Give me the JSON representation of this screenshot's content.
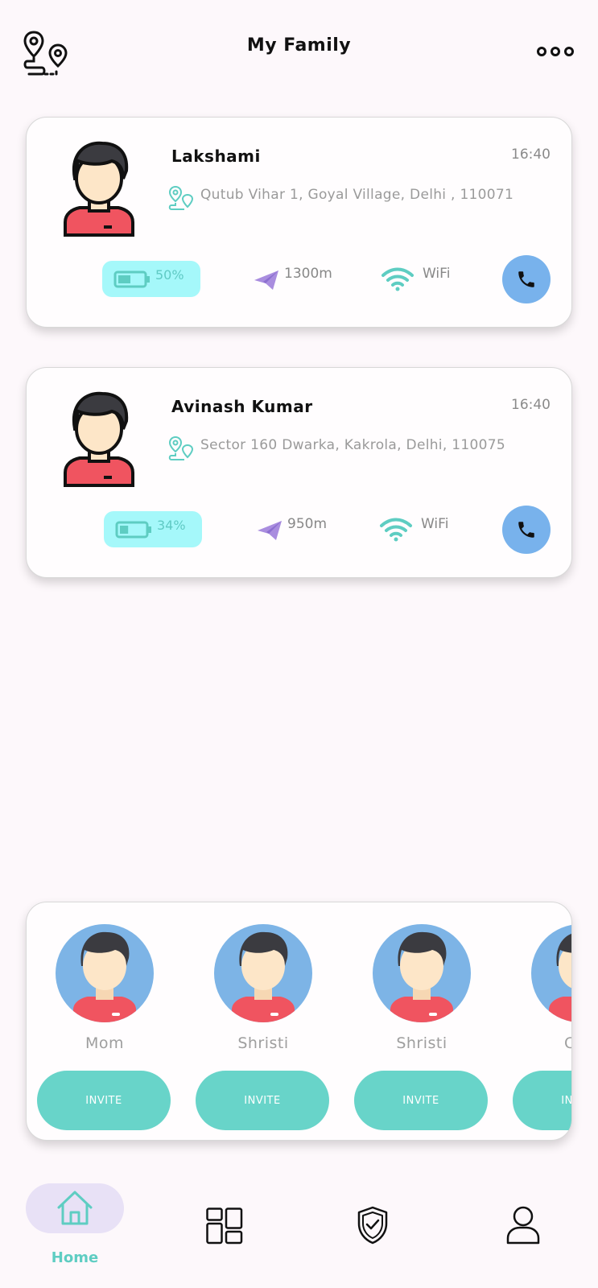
{
  "header": {
    "title": "My Family",
    "logo_icon": "map-pins-route-icon",
    "more_icon": "more-dots-icon"
  },
  "members": [
    {
      "name": "Lakshami",
      "time": "16:40",
      "address": "Qutub Vihar 1, Goyal Village, Delhi , 110071",
      "battery": "50%",
      "battery_level": 0.5,
      "distance": "1300m",
      "network": "WiFi"
    },
    {
      "name": "Avinash Kumar",
      "time": "16:40",
      "address": "Sector 160 Dwarka, Kakrola, Delhi, 110075",
      "battery": "34%",
      "battery_level": 0.34,
      "distance": "950m",
      "network": "WiFi"
    }
  ],
  "invites": [
    {
      "name": "Mom",
      "button": "INVITE"
    },
    {
      "name": "Shristi",
      "button": "INVITE"
    },
    {
      "name": "Shristi",
      "button": "INVITE"
    },
    {
      "name": "CSR",
      "button": "INVITE"
    }
  ],
  "nav": {
    "home_label": "Home",
    "items": [
      "home-icon",
      "dashboard-icon",
      "shield-check-icon",
      "profile-icon"
    ]
  },
  "colors": {
    "accent": "#5ecdc2",
    "call": "#78b2ec",
    "battery_pill": "#a5f8fa",
    "distance": "#a98ddf",
    "home_pill": "#e8e1f6"
  }
}
